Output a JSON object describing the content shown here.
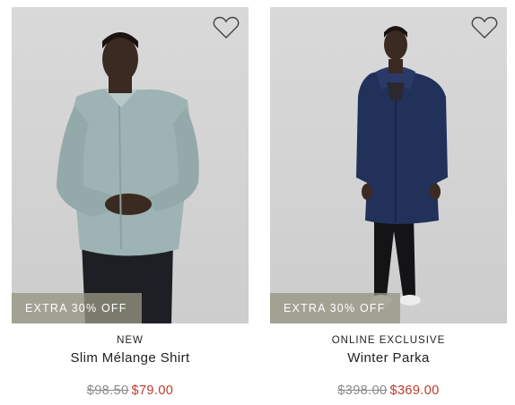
{
  "products": [
    {
      "promo": "EXTRA 30% OFF",
      "tag": "NEW",
      "name": "Slim Mélange Shirt",
      "original_price": "$98.50",
      "sale_price": "$79.00"
    },
    {
      "promo": "EXTRA 30% OFF",
      "tag": "ONLINE EXCLUSIVE",
      "name": "Winter Parka",
      "original_price": "$398.00",
      "sale_price": "$369.00"
    }
  ],
  "icons": {
    "wishlist": "heart-outline-icon"
  },
  "colors": {
    "sale": "#c0392b",
    "original": "#8a8a8a",
    "promo_bg": "#969682"
  }
}
